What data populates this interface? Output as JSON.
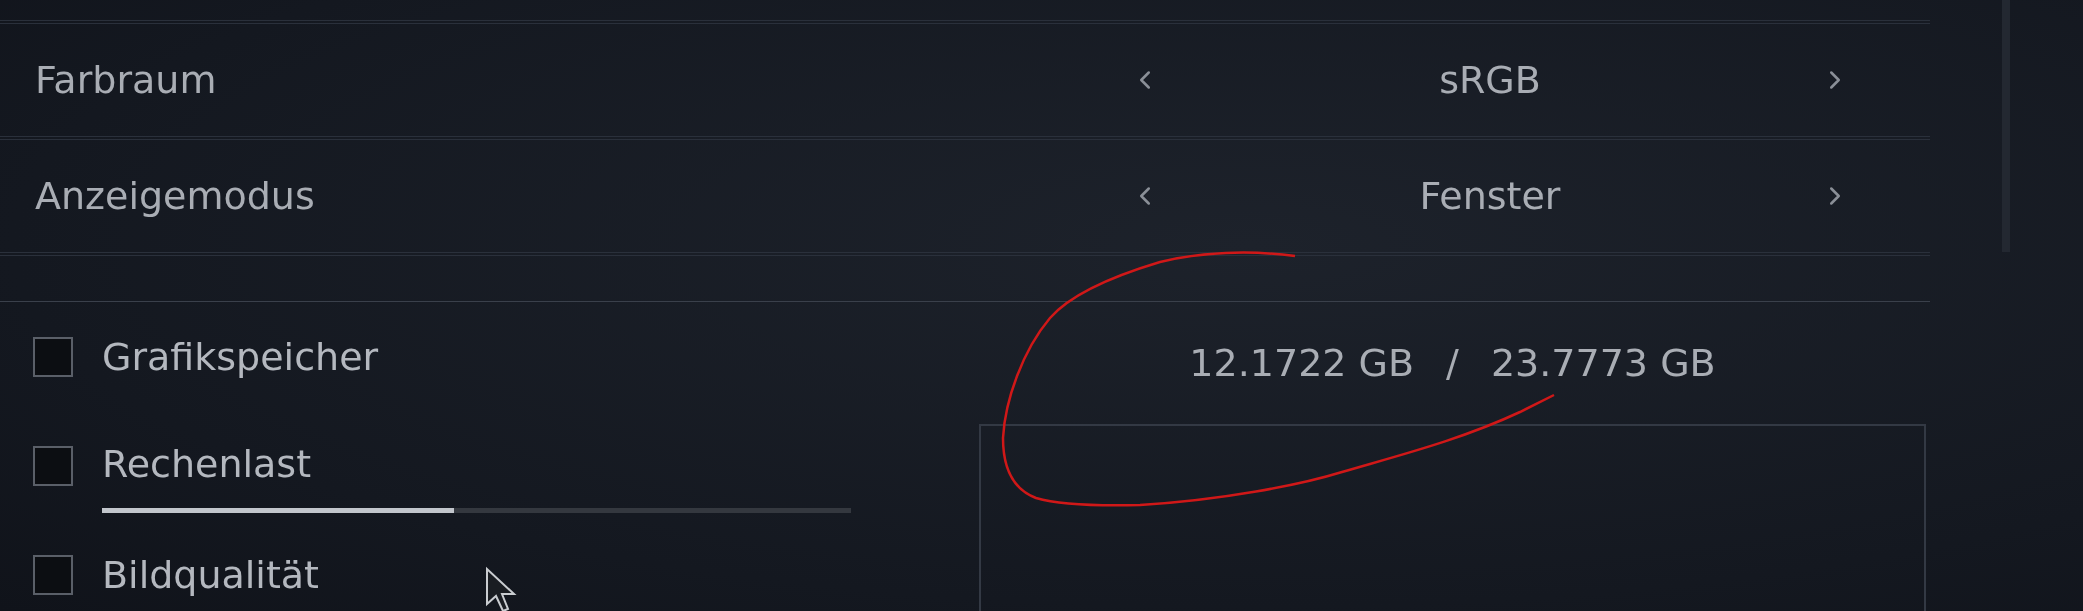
{
  "selectors": [
    {
      "label": "Farbraum",
      "value": "sRGB"
    },
    {
      "label": "Anzeigemodus",
      "value": "Fenster"
    }
  ],
  "overlays": [
    {
      "kind": "checkbox",
      "label": "Grafikspeicher",
      "checked": false
    },
    {
      "kind": "slider",
      "label": "Rechenlast",
      "checked": false,
      "level": 0.47
    },
    {
      "kind": "checkbox",
      "label": "Bildqualität",
      "checked": false
    }
  ],
  "memory": {
    "used": "12.1722 GB",
    "separator": "/",
    "total": "23.7773 GB"
  }
}
